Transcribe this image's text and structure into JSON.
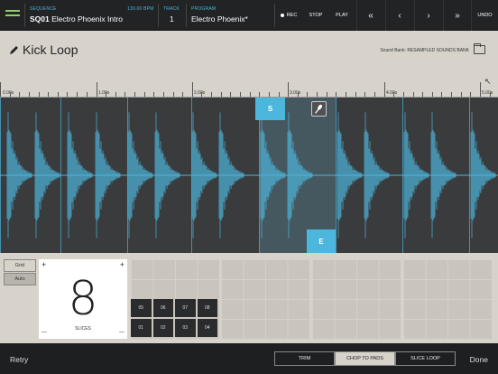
{
  "topbar": {
    "sequence_label": "SEQUENCE",
    "sequence_num": "SQ01",
    "sequence_name": "Electro Phoenix Intro",
    "bpm": "130.00 BPM",
    "track_label": "TRACK",
    "track_value": "1",
    "program_label": "PROGRAM",
    "program_value": "Electro Phoenix*",
    "rec": "REC",
    "stop": "STOP",
    "play": "PLAY",
    "nav": [
      "«",
      "‹",
      "›",
      "»"
    ],
    "undo": "UNDO"
  },
  "editor": {
    "title": "Kick Loop",
    "sound_bank": "Sound Bank: RESAMPLED SOUNDS BANK",
    "ruler_labels": [
      "0.00s",
      "1.00s",
      "2.00s",
      "3.00s",
      "4.00s",
      "5.00s"
    ],
    "start_marker": "S",
    "end_marker": "E",
    "accent": "#4db6dc"
  },
  "slices_panel": {
    "mode_grid": "Grid",
    "mode_auto": "Auto",
    "plus": "+",
    "minus": "—",
    "slice_count": "8",
    "slices_label": "SLICES",
    "pads": [
      "05",
      "06",
      "07",
      "08",
      "01",
      "02",
      "03",
      "04"
    ]
  },
  "footer": {
    "retry": "Retry",
    "trim": "TRIM",
    "chop": "CHOP TO PADS",
    "slice_loop": "SLICE LOOP",
    "done": "Done"
  }
}
